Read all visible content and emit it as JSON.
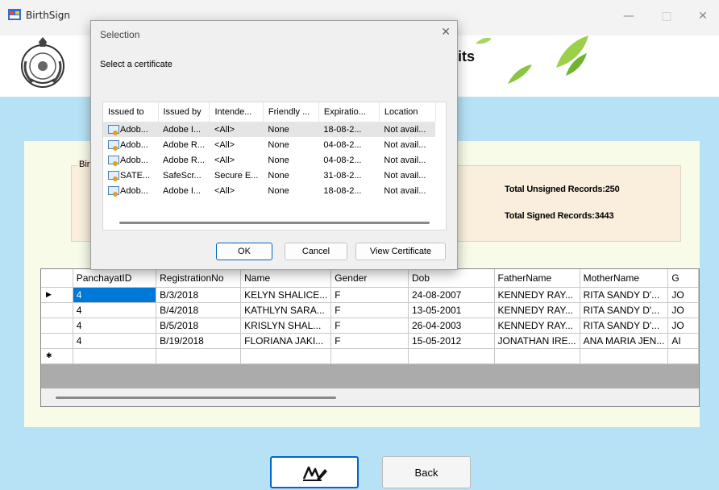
{
  "window": {
    "title": "BirthSign",
    "minimize": "—",
    "maximize": "□",
    "close": "✕"
  },
  "header": {
    "title_fragment": "its"
  },
  "group": {
    "label": "Birt",
    "unsigned": "Total Unsigned Records:250",
    "signed": "Total Signed Records:3443"
  },
  "grid": {
    "columns": [
      "PanchayatID",
      "RegistrationNo",
      "Name",
      "Gender",
      "Dob",
      "FatherName",
      "MotherName",
      "G"
    ],
    "rows": [
      [
        "4",
        "B/3/2018",
        "KELYN SHALICE...",
        "F",
        "24-08-2007",
        "KENNEDY RAY...",
        "RITA SANDY D'...",
        "JO"
      ],
      [
        "4",
        "B/4/2018",
        "KATHLYN SARA...",
        "F",
        "13-05-2001",
        "KENNEDY RAY...",
        "RITA SANDY D'...",
        "JO"
      ],
      [
        "4",
        "B/5/2018",
        "KRISLYN SHAL...",
        "F",
        "26-04-2003",
        "KENNEDY RAY...",
        "RITA SANDY D'...",
        "JO"
      ],
      [
        "4",
        "B/19/2018",
        "FLORIANA JAKI...",
        "F",
        "15-05-2012",
        "JONATHAN IRE...",
        "ANA MARIA JEN...",
        "AI"
      ]
    ],
    "current_row_marker": "▶",
    "new_row_marker": "✱"
  },
  "buttons": {
    "back": "Back",
    "sign_icon": "sign-icon"
  },
  "dialog": {
    "title": "Selection",
    "close": "✕",
    "prompt": "Select a certificate",
    "columns": [
      "Issued to",
      "Issued by",
      "Intende...",
      "Friendly ...",
      "Expiratio...",
      "Location"
    ],
    "rows": [
      [
        "Adob...",
        "Adobe I...",
        "<All>",
        "None",
        "18-08-2...",
        "Not avail..."
      ],
      [
        "Adob...",
        "Adobe R...",
        "<All>",
        "None",
        "04-08-2...",
        "Not avail..."
      ],
      [
        "Adob...",
        "Adobe R...",
        "<All>",
        "None",
        "04-08-2...",
        "Not avail..."
      ],
      [
        "SATE...",
        "SafeScr...",
        "Secure E...",
        "None",
        "31-08-2...",
        "Not avail..."
      ],
      [
        "Adob...",
        "Adobe I...",
        "<All>",
        "None",
        "18-08-2...",
        "Not avail..."
      ]
    ],
    "ok": "OK",
    "cancel": "Cancel",
    "view": "View Certificate"
  },
  "colors": {
    "accent": "#0078d7",
    "content_bg": "#b7e2f6",
    "panel_bg": "#f7fbe8",
    "group_bg": "#faefdc"
  }
}
